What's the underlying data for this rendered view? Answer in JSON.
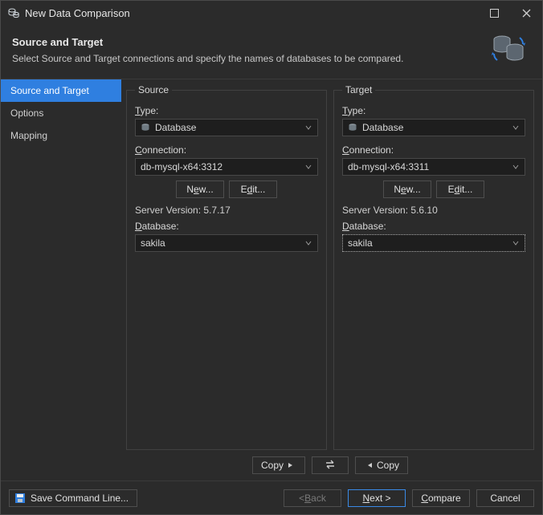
{
  "window": {
    "title": "New Data Comparison"
  },
  "header": {
    "title": "Source and Target",
    "subtitle": "Select Source and Target connections and specify the names of databases to be compared."
  },
  "sidebar": {
    "items": [
      {
        "label": "Source and Target",
        "active": true
      },
      {
        "label": "Options",
        "active": false
      },
      {
        "label": "Mapping",
        "active": false
      }
    ]
  },
  "source": {
    "legend": "Source",
    "type_label": "Type:",
    "type_value": "Database",
    "connection_label": "Connection:",
    "connection_value": "db-mysql-x64:3312",
    "new_label": "New...",
    "edit_label": "Edit...",
    "server_version_label": "Server Version:",
    "server_version_value": "5.7.17",
    "database_label": "Database:",
    "database_value": "sakila"
  },
  "target": {
    "legend": "Target",
    "type_label": "Type:",
    "type_value": "Database",
    "connection_label": "Connection:",
    "connection_value": "db-mysql-x64:3311",
    "new_label": "New...",
    "edit_label": "Edit...",
    "server_version_label": "Server Version:",
    "server_version_value": "5.6.10",
    "database_label": "Database:",
    "database_value": "sakila"
  },
  "swap": {
    "copy_right": "Copy",
    "copy_left": "Copy"
  },
  "footer": {
    "save_cmd": "Save Command Line...",
    "back": "< Back",
    "next": "Next >",
    "compare": "Compare",
    "cancel": "Cancel"
  }
}
